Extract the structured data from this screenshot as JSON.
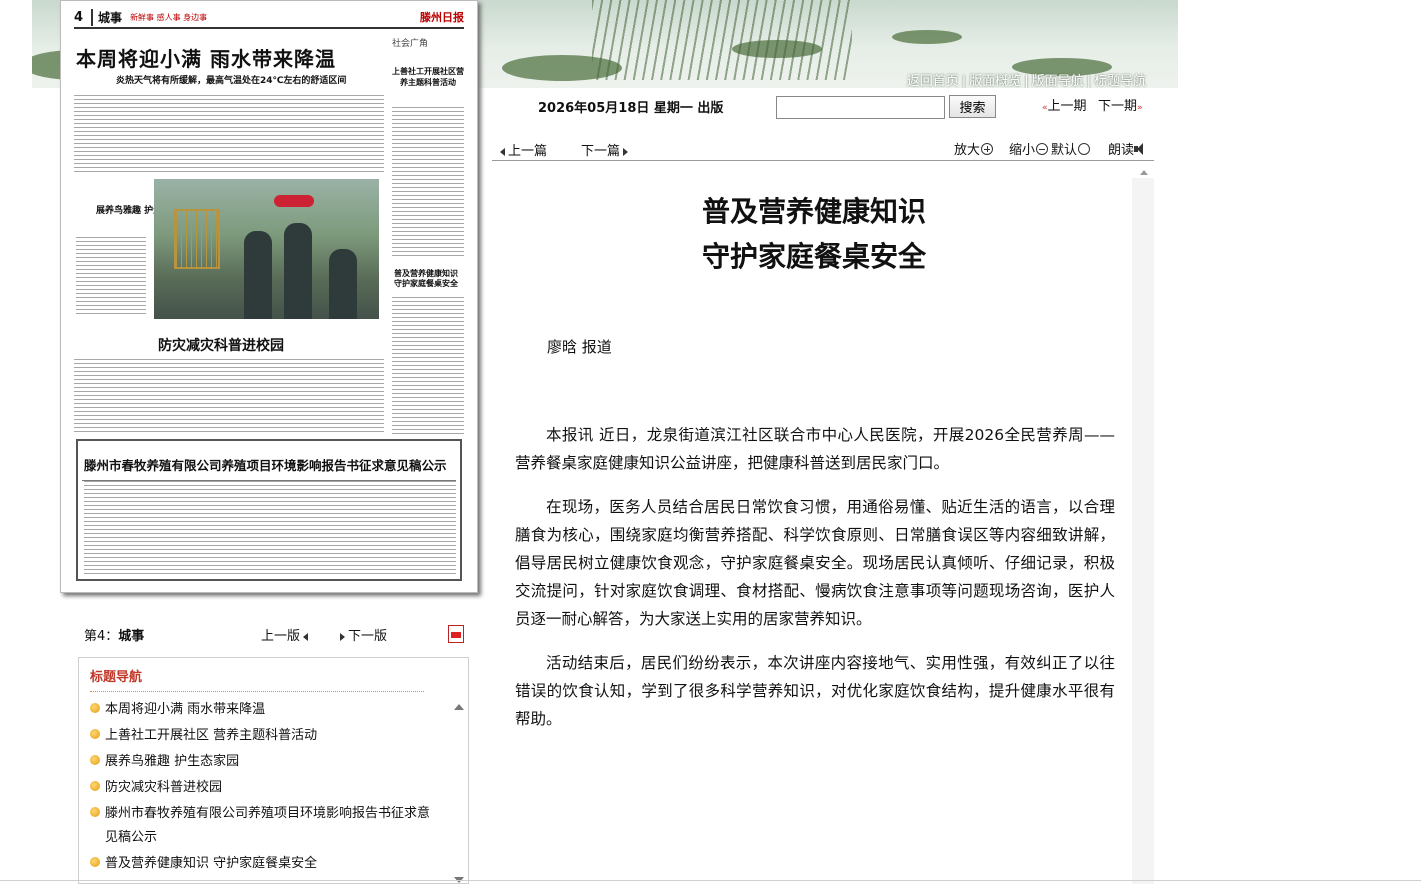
{
  "banner": {
    "links": [
      "返回首页",
      "版面概览",
      "版面导航",
      "标题导航"
    ]
  },
  "newspaper": {
    "page_number": "4",
    "section": "城事",
    "slogan": "新鲜事 感人事 身边事",
    "logo": "滕州日报",
    "headline": "本周将迎小满  雨水带来降温",
    "subheadline": "炎热天气将有所缓解，最高气温处在24℃左右的舒适区间",
    "side_tag": "社会广角",
    "side_headline": "上善社工开展社区营养主题科普活动",
    "box_title": "展养鸟雅趣 护生态家园",
    "headline2": "防灾减灾科普进校园",
    "mini_title": "普及营养健康知识 守护家庭餐桌安全",
    "notice_title": "滕州市春牧养殖有限公司养殖项目环境影响报告书征求意见稿公示"
  },
  "page_nav": {
    "current_prefix": "第4：",
    "current_section": "城事",
    "prev": "上一版",
    "next": "下一版",
    "pdf_icon": "pdf-icon"
  },
  "title_nav": {
    "heading": "标题导航",
    "items": [
      "本周将迎小满 雨水带来降温",
      "上善社工开展社区 营养主题科普活动",
      "展养鸟雅趣 护生态家园",
      "防灾减灾科普进校园",
      "滕州市春牧养殖有限公司养殖项目环境影响报告书征求意见稿公示",
      "普及营养健康知识 守护家庭餐桌安全"
    ]
  },
  "date_bar": {
    "date": "2026年05月18日 星期一 出版",
    "search_value": "",
    "search_button": "搜索",
    "prev_page": "上一期",
    "next_page": "下一期"
  },
  "toolbar": {
    "prev_article": "上一篇",
    "next_article": "下一篇",
    "zoom_in": "放大",
    "zoom_out": "缩小",
    "zoom_default": "默认",
    "read_aloud": "朗读"
  },
  "article": {
    "title_line1": "普及营养健康知识",
    "title_line2": "守护家庭餐桌安全",
    "byline": "廖晗 报道",
    "paragraphs": [
      "本报讯 近日，龙泉街道滨江社区联合市中心人民医院，开展2026全民营养周——营养餐桌家庭健康知识公益讲座，把健康科普送到居民家门口。",
      "在现场，医务人员结合居民日常饮食习惯，用通俗易懂、贴近生活的语言，以合理膳食为核心，围绕家庭均衡营养搭配、科学饮食原则、日常膳食误区等内容细致讲解，倡导居民树立健康饮食观念，守护家庭餐桌安全。现场居民认真倾听、仔细记录，积极交流提问，针对家庭饮食调理、食材搭配、慢病饮食注意事项等问题现场咨询，医护人员逐一耐心解答，为大家送上实用的居家营养知识。",
      "活动结束后，居民们纷纷表示，本次讲座内容接地气、实用性强，有效纠正了以往错误的饮食认知，学到了很多科学营养知识，对优化家庭饮食结构，提升健康水平很有帮助。"
    ]
  }
}
